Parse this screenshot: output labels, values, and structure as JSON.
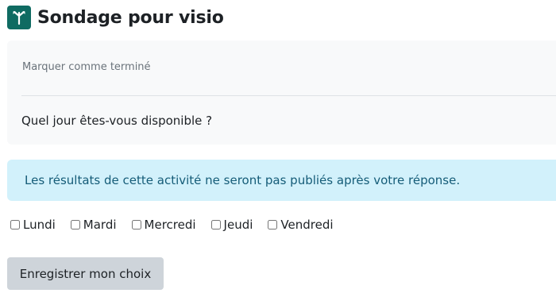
{
  "header": {
    "icon": "choice-signpost-icon",
    "title": "Sondage pour visio",
    "brand_color": "#0f6b62"
  },
  "completion": {
    "mark_done_label": "Marquer comme terminé"
  },
  "choice": {
    "question": "Quel jour êtes-vous disponible ?",
    "notice": "Les résultats de cette activité ne seront pas publiés après votre réponse.",
    "notice_color": "#d2f1fb",
    "options": [
      {
        "label": "Lundi",
        "checked": false
      },
      {
        "label": "Mardi",
        "checked": false
      },
      {
        "label": "Mercredi",
        "checked": false
      },
      {
        "label": "Jeudi",
        "checked": false
      },
      {
        "label": "Vendredi",
        "checked": false
      }
    ],
    "submit_label": "Enregistrer mon choix"
  }
}
